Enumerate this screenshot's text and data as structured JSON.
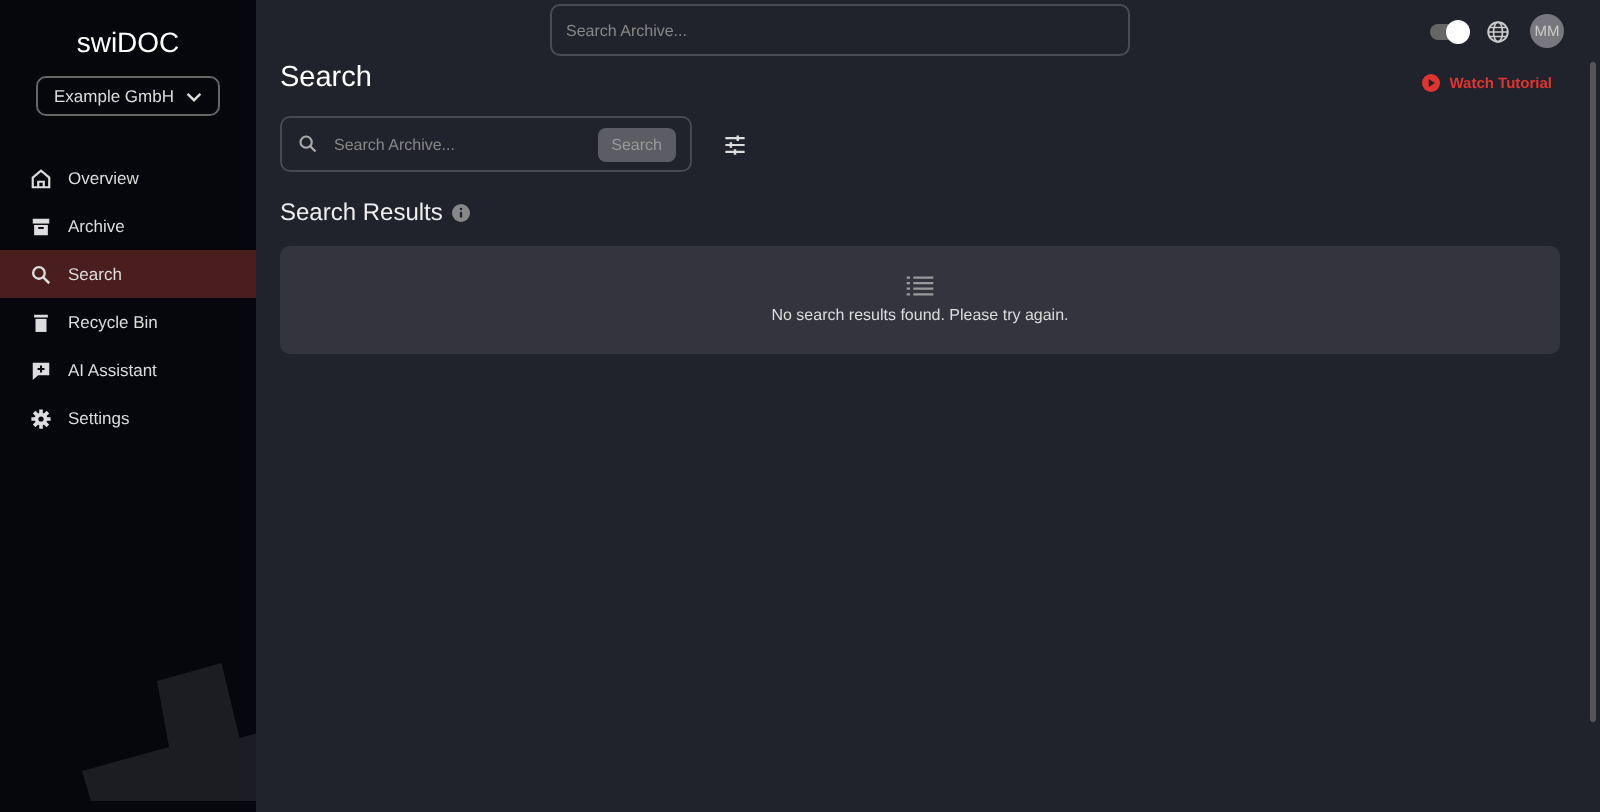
{
  "sidebar": {
    "brand": "swiDOC",
    "company": "Example GmbH",
    "items": [
      {
        "label": "Overview",
        "selected": false
      },
      {
        "label": "Archive",
        "selected": false
      },
      {
        "label": "Search",
        "selected": true
      },
      {
        "label": "Recycle Bin",
        "selected": false
      },
      {
        "label": "AI Assistant",
        "selected": false
      },
      {
        "label": "Settings",
        "selected": false
      }
    ]
  },
  "topbar": {
    "search_placeholder": "Search Archive...",
    "theme_toggle_on": true,
    "avatar": "MM"
  },
  "page": {
    "title": "Search",
    "tutorial": "Watch Tutorial",
    "search_placeholder": "Search Archive...",
    "search_button": "Search",
    "results_title": "Search Results",
    "empty_message": "No search results found. Please try again."
  }
}
